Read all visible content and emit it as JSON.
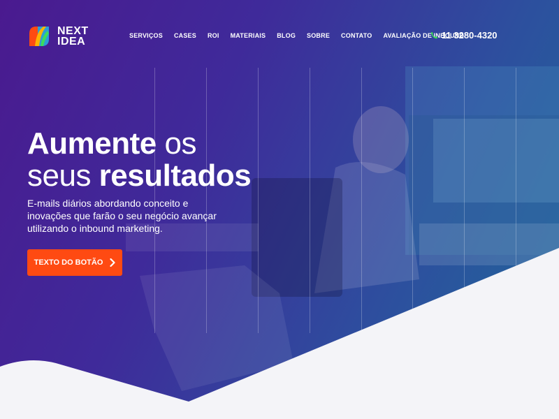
{
  "brand": {
    "name_line1": "NEXT",
    "name_line2": "IDEA"
  },
  "nav": {
    "items": [
      {
        "label": "SERVIÇOS"
      },
      {
        "label": "CASES"
      },
      {
        "label": "ROI"
      },
      {
        "label": "MATERIAIS"
      },
      {
        "label": "BLOG"
      },
      {
        "label": "SOBRE"
      },
      {
        "label": "CONTATO"
      },
      {
        "label": "AVALIAÇÃO DE INBOUND"
      }
    ],
    "phone": "11 3280-4320",
    "phone_icon": "phone-icon"
  },
  "hero": {
    "headline_bold_1": "Aumente",
    "headline_light_1": " os",
    "headline_light_2": "seus ",
    "headline_bold_2": "resultados",
    "subtext": "E-mails diários abordando conceito e inovações que farão o seu negócio avançar utilizando o inbound marketing.",
    "cta_label": "TEXTO DO BOTÃO"
  },
  "colors": {
    "accent": "#ff4a12",
    "phone_icon": "#3ddc5a",
    "background_bottom": "#f4f4f8"
  }
}
